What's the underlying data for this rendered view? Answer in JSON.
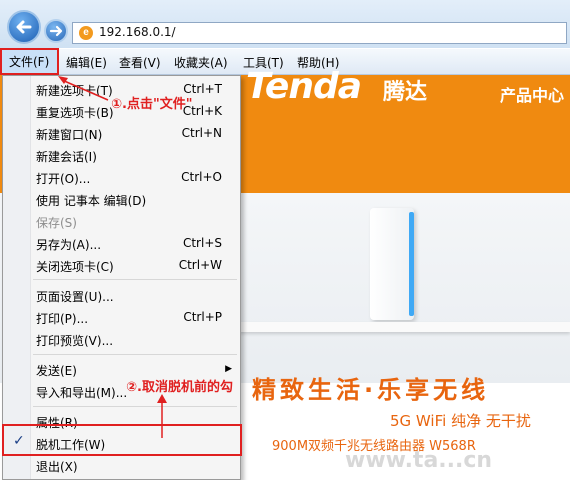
{
  "browser": {
    "address": "192.168.0.1/",
    "favicon_letter": "e"
  },
  "menubar": {
    "file": "文件(F)",
    "edit": "编辑(E)",
    "view": "查看(V)",
    "favorites": "收藏夹(A)",
    "tools": "工具(T)",
    "help": "帮助(H)"
  },
  "file_menu": {
    "items": [
      {
        "label": "新建选项卡(T)",
        "shortcut": "Ctrl+T"
      },
      {
        "label": "重复选项卡(B)",
        "shortcut": "Ctrl+K"
      },
      {
        "label": "新建窗口(N)",
        "shortcut": "Ctrl+N"
      },
      {
        "label": "新建会话(I)",
        "shortcut": ""
      },
      {
        "label": "打开(O)...",
        "shortcut": "Ctrl+O"
      },
      {
        "label": "使用 记事本 编辑(D)",
        "shortcut": ""
      },
      {
        "label": "保存(S)",
        "shortcut": ""
      },
      {
        "label": "另存为(A)...",
        "shortcut": "Ctrl+S"
      },
      {
        "label": "关闭选项卡(C)",
        "shortcut": "Ctrl+W"
      },
      {
        "label": "页面设置(U)...",
        "shortcut": ""
      },
      {
        "label": "打印(P)...",
        "shortcut": "Ctrl+P"
      },
      {
        "label": "打印预览(V)...",
        "shortcut": ""
      },
      {
        "label": "发送(E)",
        "shortcut": ""
      },
      {
        "label": "导入和导出(M)...",
        "shortcut": ""
      },
      {
        "label": "属性(R)",
        "shortcut": ""
      },
      {
        "label": "脱机工作(W)",
        "shortcut": "",
        "checked": true
      },
      {
        "label": "退出(X)",
        "shortcut": ""
      }
    ],
    "check_mark": "✓",
    "submenu_arrow": "▶"
  },
  "annotations": {
    "step1": "①.点击\"文件\"",
    "step2": "②.取消脱机前的勾"
  },
  "webpage": {
    "logo": "Tenda",
    "logo_cn": "腾达",
    "product_center": "产品中心",
    "slogan": "精致生活·乐享无线",
    "wifi_line": "5G WiFi 纯净 无干扰",
    "model_line": "900M双频千兆无线路由器   W568R",
    "watermark": "www.ta...cn"
  },
  "colors": {
    "annotation_red": "#e02020",
    "tenda_orange": "#f08a10",
    "slogan_orange": "#e8650f"
  }
}
